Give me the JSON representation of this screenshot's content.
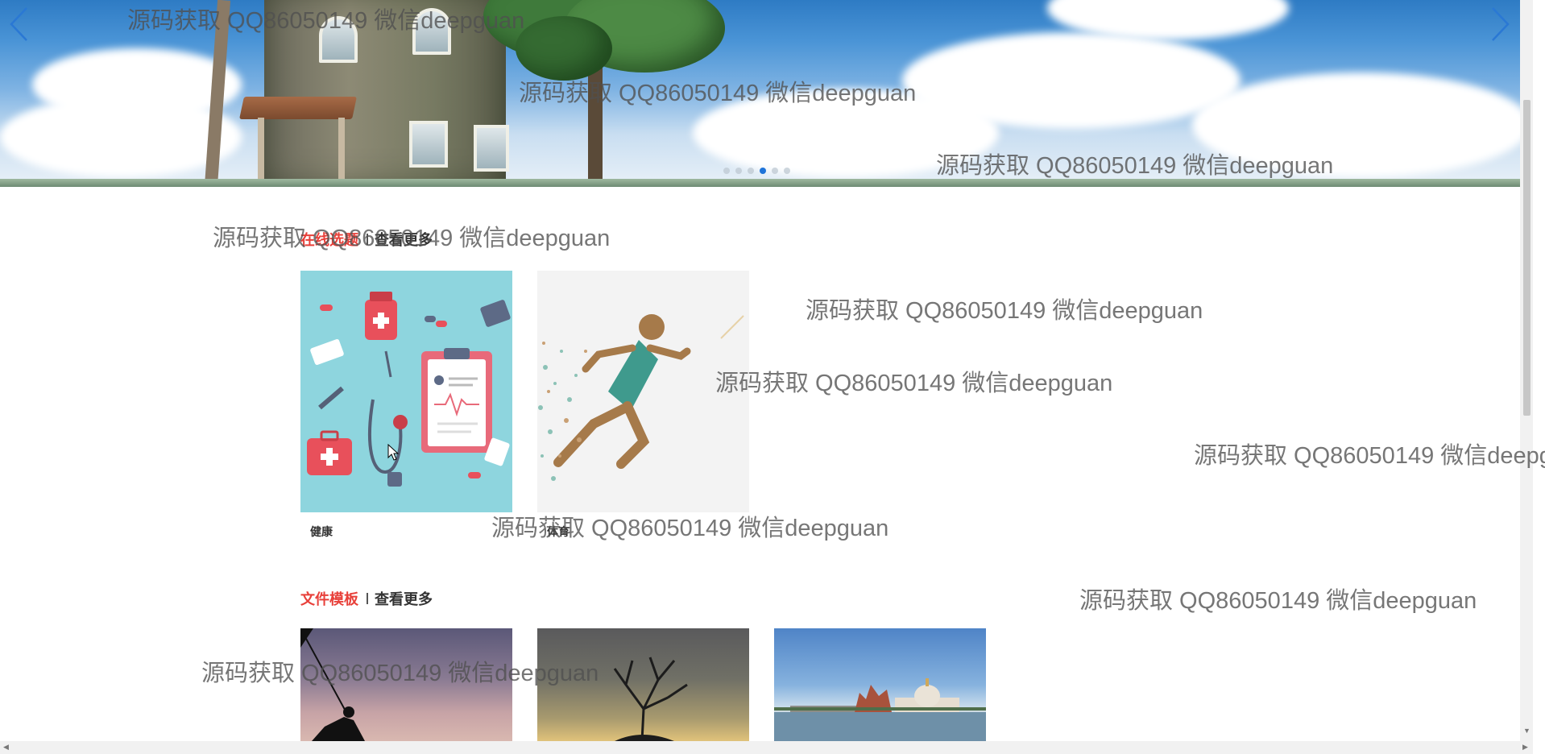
{
  "banner": {
    "prev_icon": "chevron-left-icon",
    "next_icon": "chevron-right-icon",
    "slide_count": 6,
    "active_slide": 4,
    "accent_color": "#1f74d9"
  },
  "sections": [
    {
      "title": "在线选题",
      "more_label": "查看更多",
      "cards": [
        {
          "label": "健康"
        },
        {
          "label": "体育"
        }
      ]
    },
    {
      "title": "文件模板",
      "more_label": "查看更多"
    }
  ],
  "watermark_text": "源码获取 QQ86050149 微信deepguan",
  "colors": {
    "section_title": "#e8403a",
    "health_bg": "#8ed5de",
    "sport_bg": "#f3f3f3"
  }
}
